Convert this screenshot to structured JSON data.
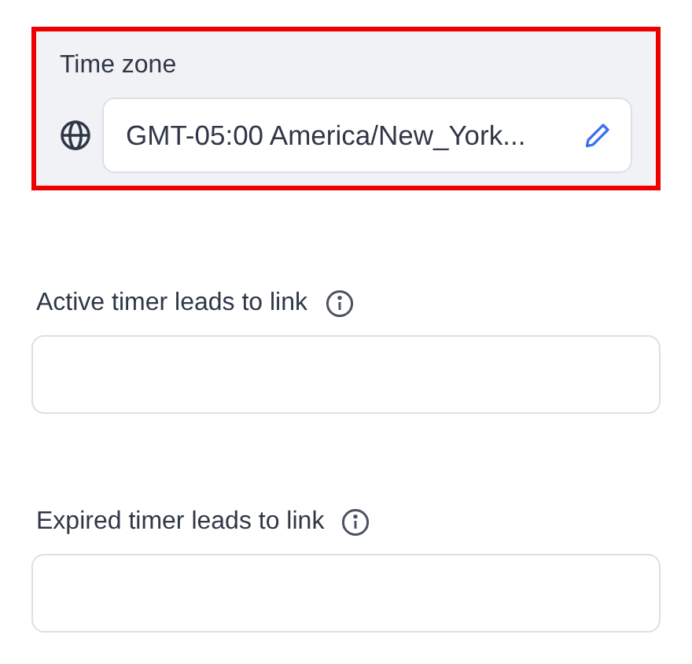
{
  "time_zone": {
    "label": "Time zone",
    "value": "GMT-05:00 America/New_York...",
    "highlighted": true
  },
  "fields": [
    {
      "label": "Active timer leads to link"
    },
    {
      "label": "Expired timer leads to link"
    }
  ]
}
